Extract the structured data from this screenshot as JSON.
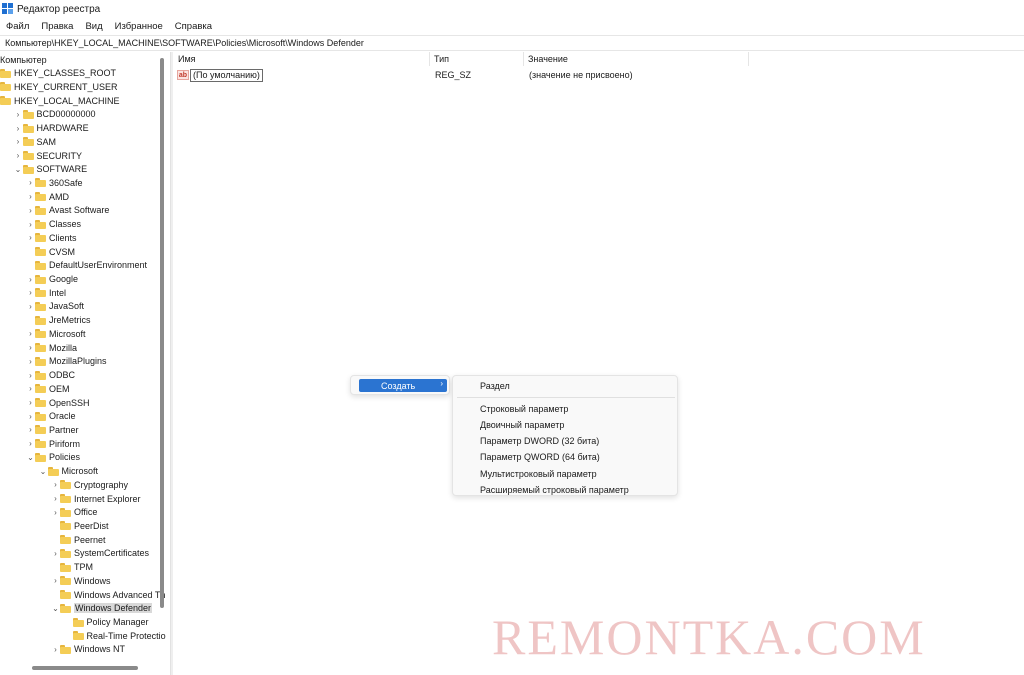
{
  "window": {
    "title": "Редактор реестра"
  },
  "menu": [
    "Файл",
    "Правка",
    "Вид",
    "Избранное",
    "Справка"
  ],
  "address": "Компьютер\\HKEY_LOCAL_MACHINE\\SOFTWARE\\Policies\\Microsoft\\Windows Defender",
  "tree": [
    {
      "label": "Компьютер",
      "depth": 0,
      "chev": "",
      "folder": false
    },
    {
      "label": "HKEY_CLASSES_ROOT",
      "depth": 0,
      "chev": "",
      "folder": true
    },
    {
      "label": "HKEY_CURRENT_USER",
      "depth": 0,
      "chev": "",
      "folder": true
    },
    {
      "label": "HKEY_LOCAL_MACHINE",
      "depth": 0,
      "chev": "",
      "folder": true
    },
    {
      "label": "BCD00000000",
      "depth": 1,
      "chev": "›",
      "folder": true
    },
    {
      "label": "HARDWARE",
      "depth": 1,
      "chev": "›",
      "folder": true
    },
    {
      "label": "SAM",
      "depth": 1,
      "chev": "›",
      "folder": true
    },
    {
      "label": "SECURITY",
      "depth": 1,
      "chev": "›",
      "folder": true
    },
    {
      "label": "SOFTWARE",
      "depth": 1,
      "chev": "⌄",
      "folder": true
    },
    {
      "label": "360Safe",
      "depth": 2,
      "chev": "›",
      "folder": true
    },
    {
      "label": "AMD",
      "depth": 2,
      "chev": "›",
      "folder": true
    },
    {
      "label": "Avast Software",
      "depth": 2,
      "chev": "›",
      "folder": true
    },
    {
      "label": "Classes",
      "depth": 2,
      "chev": "›",
      "folder": true
    },
    {
      "label": "Clients",
      "depth": 2,
      "chev": "›",
      "folder": true
    },
    {
      "label": "CVSM",
      "depth": 2,
      "chev": "",
      "folder": true
    },
    {
      "label": "DefaultUserEnvironment",
      "depth": 2,
      "chev": "",
      "folder": true
    },
    {
      "label": "Google",
      "depth": 2,
      "chev": "›",
      "folder": true
    },
    {
      "label": "Intel",
      "depth": 2,
      "chev": "›",
      "folder": true
    },
    {
      "label": "JavaSoft",
      "depth": 2,
      "chev": "›",
      "folder": true
    },
    {
      "label": "JreMetrics",
      "depth": 2,
      "chev": "",
      "folder": true
    },
    {
      "label": "Microsoft",
      "depth": 2,
      "chev": "›",
      "folder": true
    },
    {
      "label": "Mozilla",
      "depth": 2,
      "chev": "›",
      "folder": true
    },
    {
      "label": "MozillaPlugins",
      "depth": 2,
      "chev": "›",
      "folder": true
    },
    {
      "label": "ODBC",
      "depth": 2,
      "chev": "›",
      "folder": true
    },
    {
      "label": "OEM",
      "depth": 2,
      "chev": "›",
      "folder": true
    },
    {
      "label": "OpenSSH",
      "depth": 2,
      "chev": "›",
      "folder": true
    },
    {
      "label": "Oracle",
      "depth": 2,
      "chev": "›",
      "folder": true
    },
    {
      "label": "Partner",
      "depth": 2,
      "chev": "›",
      "folder": true
    },
    {
      "label": "Piriform",
      "depth": 2,
      "chev": "›",
      "folder": true
    },
    {
      "label": "Policies",
      "depth": 2,
      "chev": "⌄",
      "folder": true
    },
    {
      "label": "Microsoft",
      "depth": 3,
      "chev": "⌄",
      "folder": true
    },
    {
      "label": "Cryptography",
      "depth": 4,
      "chev": "›",
      "folder": true
    },
    {
      "label": "Internet Explorer",
      "depth": 4,
      "chev": "›",
      "folder": true
    },
    {
      "label": "Office",
      "depth": 4,
      "chev": "›",
      "folder": true
    },
    {
      "label": "PeerDist",
      "depth": 4,
      "chev": "",
      "folder": true
    },
    {
      "label": "Peernet",
      "depth": 4,
      "chev": "",
      "folder": true
    },
    {
      "label": "SystemCertificates",
      "depth": 4,
      "chev": "›",
      "folder": true
    },
    {
      "label": "TPM",
      "depth": 4,
      "chev": "",
      "folder": true
    },
    {
      "label": "Windows",
      "depth": 4,
      "chev": "›",
      "folder": true
    },
    {
      "label": "Windows Advanced Th",
      "depth": 4,
      "chev": "",
      "folder": true
    },
    {
      "label": "Windows Defender",
      "depth": 4,
      "chev": "⌄",
      "folder": true,
      "selected": true
    },
    {
      "label": "Policy Manager",
      "depth": 5,
      "chev": "",
      "folder": true
    },
    {
      "label": "Real-Time Protectio",
      "depth": 5,
      "chev": "",
      "folder": true
    },
    {
      "label": "Windows NT",
      "depth": 4,
      "chev": "›",
      "folder": true
    }
  ],
  "list": {
    "columns": [
      "Имя",
      "Тип",
      "Значение"
    ],
    "rows": [
      {
        "icon": "ab",
        "name": "(По умолчанию)",
        "type": "REG_SZ",
        "value": "(значение не присвоено)"
      }
    ]
  },
  "context_menu": {
    "create_label": "Создать",
    "submenu_arrow": "›",
    "submenu": [
      "Раздел",
      "Строковый параметр",
      "Двоичный параметр",
      "Параметр DWORD (32 бита)",
      "Параметр QWORD (64 бита)",
      "Мультистроковый параметр",
      "Расширяемый строковый параметр"
    ]
  },
  "watermark": "REMONTKA.COM",
  "colors": {
    "accent": "#2b74d1",
    "folder": "#f4cd56",
    "watermark": "#e29696"
  }
}
